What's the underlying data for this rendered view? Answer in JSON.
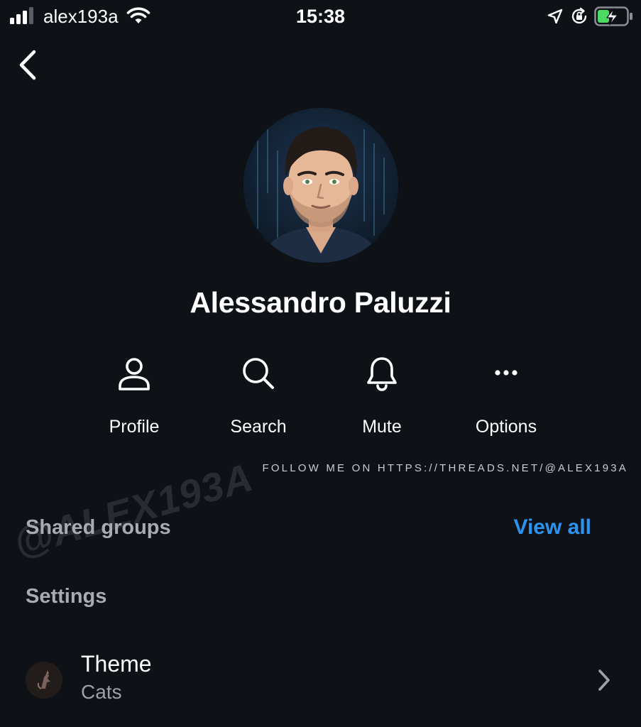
{
  "status_bar": {
    "carrier": "alex193a",
    "time": "15:38",
    "signal_bars": 3,
    "battery_charging": true
  },
  "profile": {
    "name": "Alessandro Paluzzi"
  },
  "actions": [
    {
      "label": "Profile",
      "icon": "person-icon"
    },
    {
      "label": "Search",
      "icon": "search-icon"
    },
    {
      "label": "Mute",
      "icon": "bell-icon"
    },
    {
      "label": "Options",
      "icon": "more-icon"
    }
  ],
  "watermarks": {
    "follow": "FOLLOW ME ON HTTPS://THREADS.NET/@ALEX193A",
    "handle": "@ALEX193A"
  },
  "shared_groups": {
    "title": "Shared groups",
    "view_all": "View all"
  },
  "settings": {
    "title": "Settings",
    "theme": {
      "label": "Theme",
      "value": "Cats",
      "icon": "cat-theme-icon"
    }
  },
  "colors": {
    "background": "#0e1116",
    "accent": "#2b93f0",
    "section_title": "#a7abb2",
    "secondary_text": "#9ca1a8",
    "battery": "#4cd964"
  }
}
